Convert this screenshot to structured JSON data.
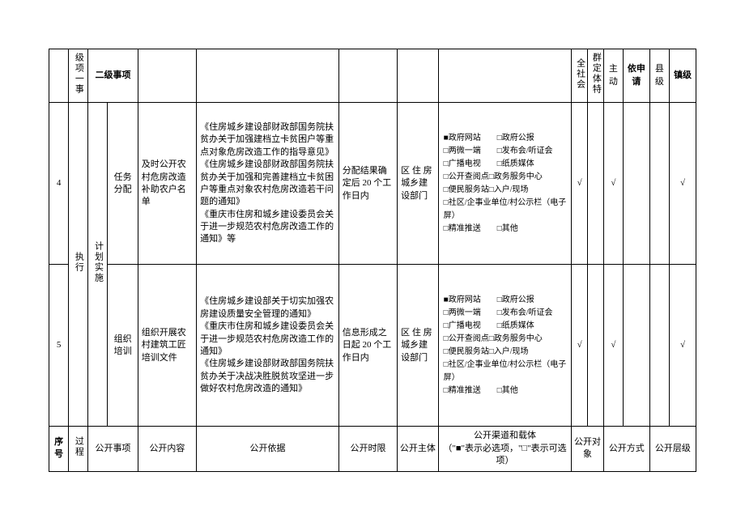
{
  "header_top": {
    "c1": "",
    "c2": "级项一事",
    "c3": "二级事项",
    "c4": "",
    "c5": "",
    "c6": "",
    "c7": "",
    "c8": "",
    "c9": "全社会",
    "c10": "群定体特",
    "c11": "主动",
    "c12": "依申请",
    "c13": "县级",
    "c14": "镇级"
  },
  "group": {
    "exec": "执行",
    "plan": "计划实施"
  },
  "row4": {
    "num": "4",
    "l3": "任务分配",
    "content": "及时公开农村危房改造补助农户名单",
    "basis": "《住房城乡建设部财政部国务院扶贫办关于加强建档立卡贫困户等重点对象危房改造工作的指导意见》\n《住房城乡建设部财政部国务院扶贫办关于加强和完善建档立卡贫困户等重点对象农村危房改造若干问题的通知》\n《重庆市住房和城乡建设委员会关于进一步规范农村危房改造工作的通知》等",
    "time": "分配结果确定后 20 个工作日内",
    "subject": "区 住 房 城乡建设部门",
    "channels": "■政府网站　　□政府公报\n□两微一端　　□发布会/听证会\n□广播电视　　□纸质媒体\n□公开查阅点□政务服务中心\n□便民服务站□入户/现场\n□社区/企事业单位/村公示栏（电子屏）\n□精准推送　　□其他",
    "soc": "√",
    "grp": "",
    "active": "√",
    "req": "",
    "county": "",
    "town": "√"
  },
  "row5": {
    "num": "5",
    "l3": "组织培训",
    "content": "组织开展农村建筑工匠培训文件",
    "basis": "《住房城乡建设部关于切实加强农房建设质量安全管理的通知》\n《重庆市住房和城乡建设委员会关于进一步规范农村危房改造工作的通知》\n《住房城乡建设部财政部国务院扶贫办关于决战决胜脱贫攻坚进一步做好农村危房改造的通知》",
    "time": "信息形成之日起 20 个工作日内",
    "subject": "区 住 房 城乡建设部门",
    "channels": "■政府网站　　□政府公报\n□两微一端　　□发布会/听证会\n□广播电视　　□纸质媒体\n□公开查阅点□政务服务中心\n□便民服务站□入户/现场\n□社区/企事业单位/村公示栏（电子屏）\n□精准推送　　□其他",
    "soc": "√",
    "grp": "",
    "active": "√",
    "req": "",
    "county": "",
    "town": "√"
  },
  "footer": {
    "seq": "序号",
    "process": "过程",
    "item": "公开事项",
    "content": "公开内容",
    "basis": "公开依据",
    "time": "公开时限",
    "subject": "公开主体",
    "channel": "公开渠道和载体",
    "channel_note": "（\"■\"表示必选项，\"□\"表示可选项）",
    "target": "公开对象",
    "method": "公开方式",
    "level": "公开层级"
  }
}
